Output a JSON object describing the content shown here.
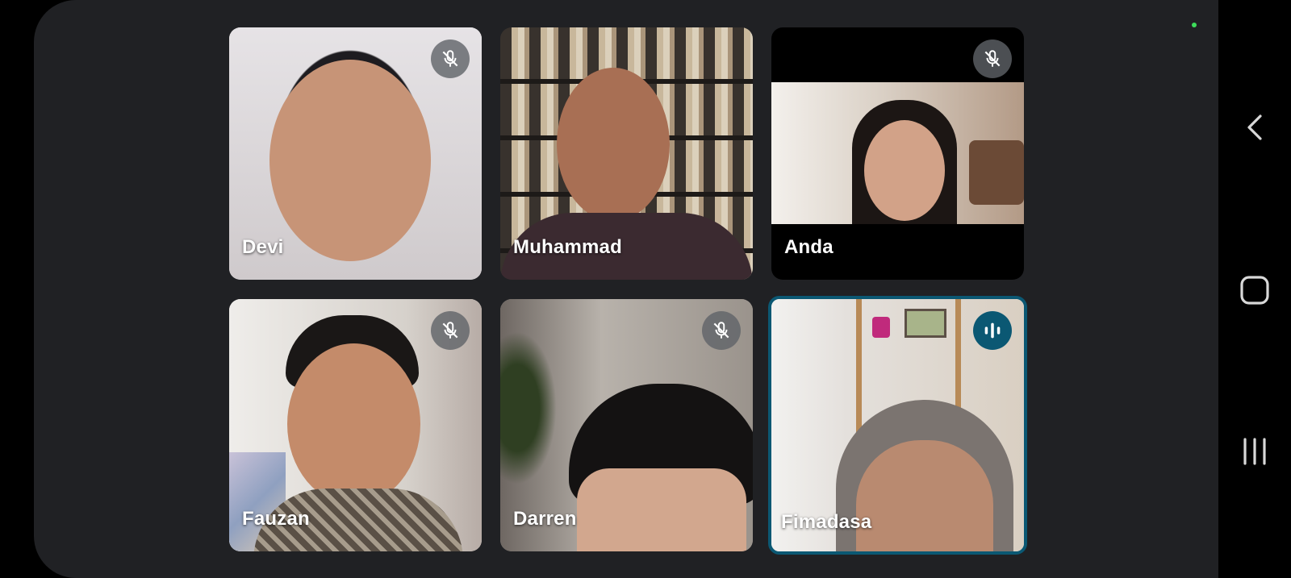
{
  "participants": [
    {
      "name": "Devi",
      "muted": true
    },
    {
      "name": "Muhammad",
      "muted": false
    },
    {
      "name": "Anda",
      "muted": true
    },
    {
      "name": "Fauzan",
      "muted": true
    },
    {
      "name": "Darren",
      "muted": true
    },
    {
      "name": "Fimadasa",
      "muted": false,
      "speaking": true
    }
  ],
  "colors": {
    "background": "#202124",
    "active_speaker": "#0b5873",
    "status_dot": "#3ddc5a"
  },
  "icons": {
    "mute": "mic-off-icon",
    "speaking": "audio-level-icon",
    "nav_back": "back-chevron-icon",
    "nav_home": "home-square-icon",
    "nav_recents": "recents-bars-icon"
  }
}
